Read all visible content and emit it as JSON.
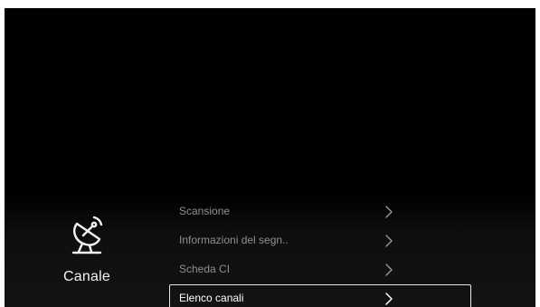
{
  "category": {
    "icon": "satellite-dish-icon",
    "label": "Canale"
  },
  "menu": {
    "items": [
      {
        "label": "Scansione",
        "icon": "chevron-right-icon",
        "focused": false
      },
      {
        "label": "Informazioni del segn..",
        "icon": "chevron-right-icon",
        "focused": false
      },
      {
        "label": "Scheda CI",
        "icon": "chevron-right-icon",
        "focused": false
      },
      {
        "label": "Elenco canali",
        "icon": "chevron-right-icon",
        "focused": true
      }
    ]
  },
  "colors": {
    "background": "#000000",
    "text_dim": "#8f8f8f",
    "text_focused": "#ffffff",
    "focus_border": "#e6e6e6"
  }
}
